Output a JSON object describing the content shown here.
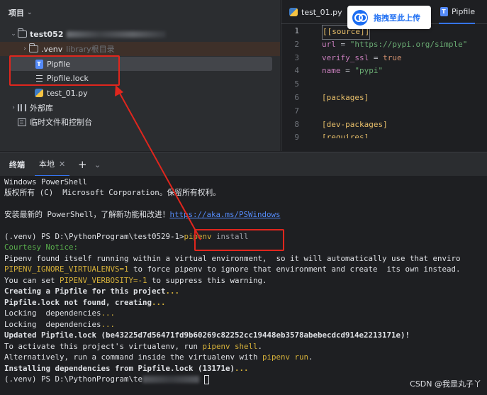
{
  "project": {
    "title": "项目",
    "root_name": "test0529-1",
    "items": [
      {
        "label": ".venv",
        "hint": "library根目录"
      },
      {
        "label": "Pipfile"
      },
      {
        "label": "Pipfile.lock"
      },
      {
        "label": "test_01.py"
      },
      {
        "label": "外部库"
      },
      {
        "label": "临时文件和控制台"
      }
    ]
  },
  "editor": {
    "tabs": [
      {
        "label": "test_01.py"
      },
      {
        "label": "Pipfile"
      }
    ],
    "line_numbers": [
      "1",
      "2",
      "3",
      "4",
      "5",
      "6",
      "7",
      "8",
      "9"
    ],
    "code": {
      "l1": "[[source]]",
      "l2_key": "url",
      "l2_eq": " = ",
      "l2_val": "\"https://pypi.org/simple\"",
      "l3_key": "verify_ssl",
      "l3_eq": " = ",
      "l3_val": "true",
      "l4_key": "name",
      "l4_eq": " = ",
      "l4_val": "\"pypi\"",
      "l6": "[packages]",
      "l8": "[dev-packages]",
      "l9": "[requires]"
    }
  },
  "upload_badge": {
    "label": "拖拽至此上传"
  },
  "terminal_tabs": {
    "title": "终端",
    "local": "本地",
    "add": "+",
    "more": "⌄"
  },
  "terminal": {
    "lines": [
      "Windows PowerShell",
      "版权所有 (C)  Microsoft Corporation。保留所有权利。",
      "安装最新的 PowerShell，了解新功能和改进！",
      "https://aka.ms/PSWindows"
    ],
    "prompt": "(.venv) PS D:\\PythonProgram\\test0529-1>",
    "cmd_name": "pipenv",
    "cmd_arg": " install",
    "courtesy": "Courtesy Notice:",
    "msg1": "Pipenv found itself running within a virtual environment,  so it will automatically use that enviro",
    "msg2_var": "PIPENV_IGNORE_VIRTUALENVS=1",
    "msg2_rest": " to force pipenv to ignore that environment and create  its own instead.",
    "msg3_pre": "You can set ",
    "msg3_var": "PIPENV_VERBOSITY=-1",
    "msg3_rest": " to suppress this warning.",
    "create_pre": "Creating a Pipfile for this project",
    "dots": "...",
    "lock_pre": "Pipfile.lock not found, creating",
    "locking": "Locking  dependencies",
    "updated": "Updated Pipfile.lock (be43225d7d56471fd9b60269c82252cc19448eb3578abebecdcd914e2213171e)!",
    "activate_pre": "To activate this project's virtualenv, run ",
    "activate_cmd": "pipenv shell",
    "activate_end": ".",
    "alt_pre": "Alternatively, run a command inside the virtualenv with ",
    "alt_cmd": "pipenv run",
    "alt_end": ".",
    "install_line": "Installing dependencies from Pipfile.lock (13171e)",
    "last_prompt": "(.venv) PS D:\\PythonProgram\\te"
  },
  "watermark": "CSDN @我是丸子丫",
  "colors": {
    "accent": "#3574f0",
    "annotation_red": "#e0261d",
    "green": "#5ab04d",
    "yellow": "#d6b13a"
  }
}
